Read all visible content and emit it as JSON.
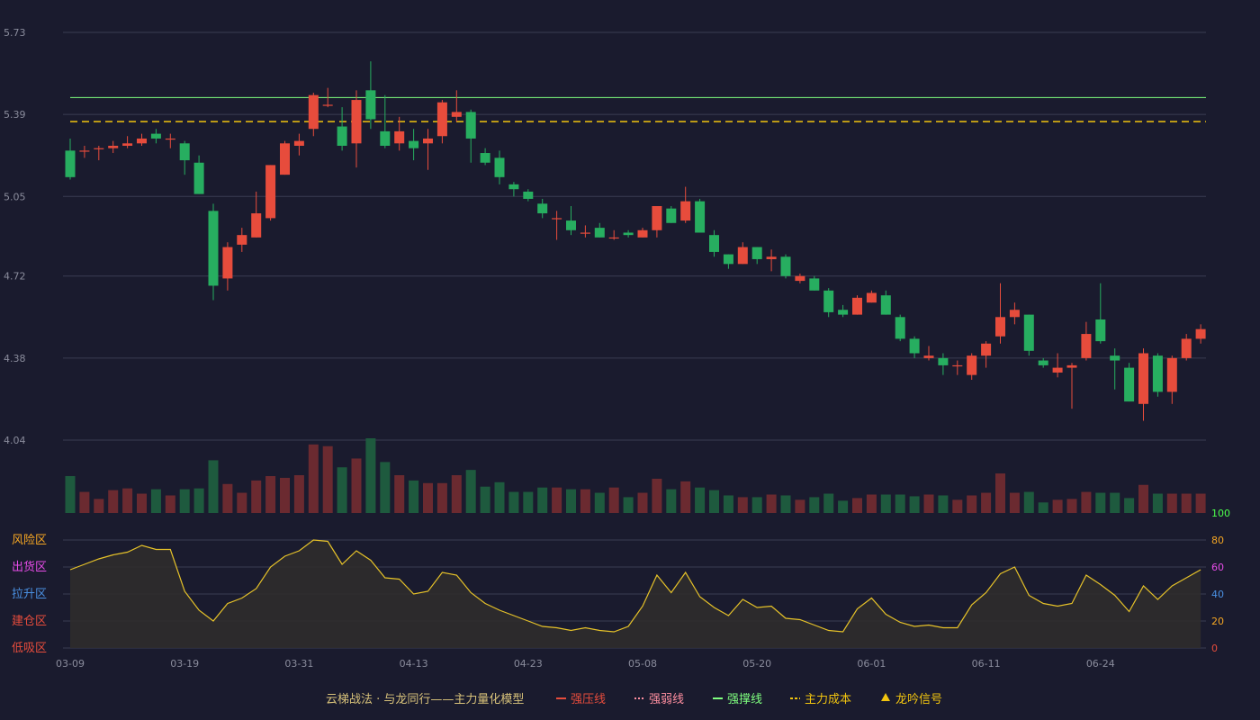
{
  "colors": {
    "background": "#1a1b2e",
    "grid": "#3a3c52",
    "axis_text": "#8a8c9c",
    "up": "#e74c3c",
    "down": "#27ae60",
    "vol_up": "#6b2a30",
    "vol_down": "#1e5a3e",
    "support_line": "#7fff7f",
    "cost_line": "#f1c40f",
    "indicator_line": "#e6c229",
    "indicator_fill": "#2f2c2c"
  },
  "chart_data": {
    "type": "candlestick",
    "price_axis": {
      "ticks": [
        "5.73",
        "5.39",
        "5.05",
        "4.72",
        "4.38",
        "4.04"
      ],
      "range": [
        4.04,
        5.73
      ]
    },
    "x_axis": {
      "ticks": [
        "03-09",
        "03-19",
        "03-31",
        "04-13",
        "04-23",
        "05-08",
        "05-20",
        "06-01",
        "06-11",
        "06-24"
      ]
    },
    "candles": [
      [
        5.24,
        5.13,
        5.29,
        5.12
      ],
      [
        5.24,
        5.24,
        5.26,
        5.21
      ],
      [
        5.25,
        5.25,
        5.26,
        5.2
      ],
      [
        5.25,
        5.26,
        5.28,
        5.23
      ],
      [
        5.26,
        5.27,
        5.3,
        5.25
      ],
      [
        5.27,
        5.29,
        5.31,
        5.26
      ],
      [
        5.31,
        5.29,
        5.33,
        5.27
      ],
      [
        5.29,
        5.29,
        5.31,
        5.25
      ],
      [
        5.27,
        5.2,
        5.28,
        5.14
      ],
      [
        5.19,
        5.06,
        5.22,
        5.06
      ],
      [
        4.99,
        4.68,
        5.02,
        4.62
      ],
      [
        4.71,
        4.84,
        4.86,
        4.66
      ],
      [
        4.85,
        4.89,
        4.92,
        4.82
      ],
      [
        4.88,
        4.98,
        5.07,
        4.88
      ],
      [
        4.96,
        5.18,
        5.18,
        4.95
      ],
      [
        5.14,
        5.27,
        5.28,
        5.14
      ],
      [
        5.26,
        5.28,
        5.31,
        5.22
      ],
      [
        5.33,
        5.47,
        5.48,
        5.3
      ],
      [
        5.43,
        5.43,
        5.5,
        5.42
      ],
      [
        5.34,
        5.26,
        5.42,
        5.24
      ],
      [
        5.27,
        5.45,
        5.49,
        5.17
      ],
      [
        5.49,
        5.37,
        5.61,
        5.33
      ],
      [
        5.32,
        5.26,
        5.47,
        5.25
      ],
      [
        5.27,
        5.32,
        5.38,
        5.24
      ],
      [
        5.28,
        5.25,
        5.33,
        5.2
      ],
      [
        5.27,
        5.29,
        5.33,
        5.16
      ],
      [
        5.3,
        5.44,
        5.45,
        5.27
      ],
      [
        5.38,
        5.4,
        5.49,
        5.36
      ],
      [
        5.4,
        5.29,
        5.41,
        5.19
      ],
      [
        5.23,
        5.19,
        5.25,
        5.18
      ],
      [
        5.21,
        5.13,
        5.24,
        5.1
      ],
      [
        5.1,
        5.08,
        5.11,
        5.05
      ],
      [
        5.07,
        5.04,
        5.08,
        5.03
      ],
      [
        5.02,
        4.98,
        5.04,
        4.96
      ],
      [
        4.96,
        4.96,
        4.99,
        4.87
      ],
      [
        4.95,
        4.91,
        5.01,
        4.89
      ],
      [
        4.9,
        4.9,
        4.93,
        4.88
      ],
      [
        4.92,
        4.88,
        4.94,
        4.88
      ],
      [
        4.88,
        4.88,
        4.91,
        4.87
      ],
      [
        4.9,
        4.89,
        4.91,
        4.88
      ],
      [
        4.88,
        4.91,
        4.92,
        4.88
      ],
      [
        4.91,
        5.01,
        5.01,
        4.88
      ],
      [
        5.0,
        4.94,
        5.01,
        4.94
      ],
      [
        4.95,
        5.03,
        5.09,
        4.94
      ],
      [
        5.03,
        4.9,
        5.04,
        4.9
      ],
      [
        4.89,
        4.82,
        4.91,
        4.8
      ],
      [
        4.81,
        4.77,
        4.81,
        4.75
      ],
      [
        4.77,
        4.84,
        4.86,
        4.77
      ],
      [
        4.84,
        4.79,
        4.84,
        4.77
      ],
      [
        4.79,
        4.8,
        4.83,
        4.74
      ],
      [
        4.8,
        4.72,
        4.81,
        4.71
      ],
      [
        4.7,
        4.72,
        4.73,
        4.69
      ],
      [
        4.71,
        4.66,
        4.72,
        4.66
      ],
      [
        4.66,
        4.57,
        4.67,
        4.55
      ],
      [
        4.58,
        4.56,
        4.6,
        4.55
      ],
      [
        4.56,
        4.63,
        4.64,
        4.56
      ],
      [
        4.61,
        4.65,
        4.66,
        4.61
      ],
      [
        4.64,
        4.56,
        4.66,
        4.56
      ],
      [
        4.55,
        4.46,
        4.56,
        4.45
      ],
      [
        4.46,
        4.4,
        4.47,
        4.38
      ],
      [
        4.38,
        4.39,
        4.43,
        4.37
      ],
      [
        4.38,
        4.35,
        4.4,
        4.31
      ],
      [
        4.35,
        4.35,
        4.37,
        4.31
      ],
      [
        4.31,
        4.39,
        4.4,
        4.29
      ],
      [
        4.39,
        4.44,
        4.45,
        4.34
      ],
      [
        4.47,
        4.55,
        4.69,
        4.44
      ],
      [
        4.55,
        4.58,
        4.61,
        4.52
      ],
      [
        4.56,
        4.41,
        4.56,
        4.39
      ],
      [
        4.37,
        4.35,
        4.38,
        4.34
      ],
      [
        4.32,
        4.34,
        4.4,
        4.3
      ],
      [
        4.34,
        4.35,
        4.36,
        4.17
      ],
      [
        4.38,
        4.48,
        4.53,
        4.37
      ],
      [
        4.54,
        4.45,
        4.69,
        4.44
      ],
      [
        4.39,
        4.37,
        4.42,
        4.25
      ],
      [
        4.34,
        4.2,
        4.36,
        4.2
      ],
      [
        4.19,
        4.4,
        4.42,
        4.12
      ],
      [
        4.39,
        4.24,
        4.4,
        4.22
      ],
      [
        4.24,
        4.38,
        4.39,
        4.19
      ],
      [
        4.38,
        4.46,
        4.48,
        4.37
      ],
      [
        4.46,
        4.5,
        4.52,
        4.44
      ]
    ],
    "volume": [
      42,
      24,
      16,
      26,
      28,
      22,
      27,
      20,
      27,
      28,
      60,
      33,
      23,
      37,
      42,
      40,
      43,
      78,
      76,
      52,
      62,
      85,
      58,
      43,
      37,
      34,
      34,
      43,
      49,
      30,
      35,
      24,
      24,
      29,
      29,
      27,
      27,
      23,
      29,
      18,
      23,
      39,
      27,
      36,
      29,
      26,
      20,
      18,
      18,
      21,
      20,
      15,
      18,
      22,
      14,
      17,
      21,
      21,
      21,
      19,
      21,
      20,
      15,
      20,
      23,
      45,
      23,
      24,
      12,
      15,
      16,
      24,
      23,
      23,
      17,
      32,
      22,
      22,
      22,
      22
    ],
    "indicator": {
      "axis_ticks": [
        "100",
        "80",
        "60",
        "40",
        "20",
        "0"
      ],
      "axis_tick_colors": [
        "#4cff4c",
        "#f5a623",
        "#e74ce8",
        "#4a90e2",
        "#f5a623",
        "#e74c3c"
      ],
      "zones": [
        {
          "label": "风险区",
          "color": "#f5a623"
        },
        {
          "label": "出货区",
          "color": "#e74ce8"
        },
        {
          "label": "拉升区",
          "color": "#4a90e2"
        },
        {
          "label": "建仓区",
          "color": "#e74c3c"
        },
        {
          "label": "低吸区",
          "color": "#e74c3c"
        }
      ],
      "values": [
        58,
        62,
        66,
        69,
        71,
        76,
        73,
        73,
        42,
        28,
        20,
        33,
        37,
        44,
        60,
        68,
        72,
        80,
        79,
        62,
        72,
        65,
        52,
        51,
        40,
        42,
        56,
        54,
        41,
        33,
        28,
        24,
        20,
        16,
        15,
        13,
        15,
        13,
        12,
        16,
        31,
        54,
        41,
        56,
        38,
        30,
        24,
        36,
        30,
        31,
        22,
        21,
        17,
        13,
        12,
        29,
        37,
        25,
        19,
        16,
        17,
        15,
        15,
        32,
        41,
        55,
        60,
        39,
        33,
        31,
        33,
        54,
        47,
        39,
        27,
        46,
        36,
        46,
        52,
        58
      ]
    },
    "reference_lines": {
      "support": 5.46,
      "cost": 5.36
    }
  },
  "legend": {
    "title": "云梯战法 · 与龙同行——主力量化模型",
    "items": [
      {
        "label": "强压线",
        "color": "#e74c3c",
        "style": "solid"
      },
      {
        "label": "强弱线",
        "color": "#ff8fa0",
        "style": "dotted"
      },
      {
        "label": "强撑线",
        "color": "#7fff7f",
        "style": "solid"
      },
      {
        "label": "主力成本",
        "color": "#f1c40f",
        "style": "dashed"
      },
      {
        "label": "龙吟信号",
        "color": "#f1c40f",
        "style": "triangle"
      }
    ]
  }
}
